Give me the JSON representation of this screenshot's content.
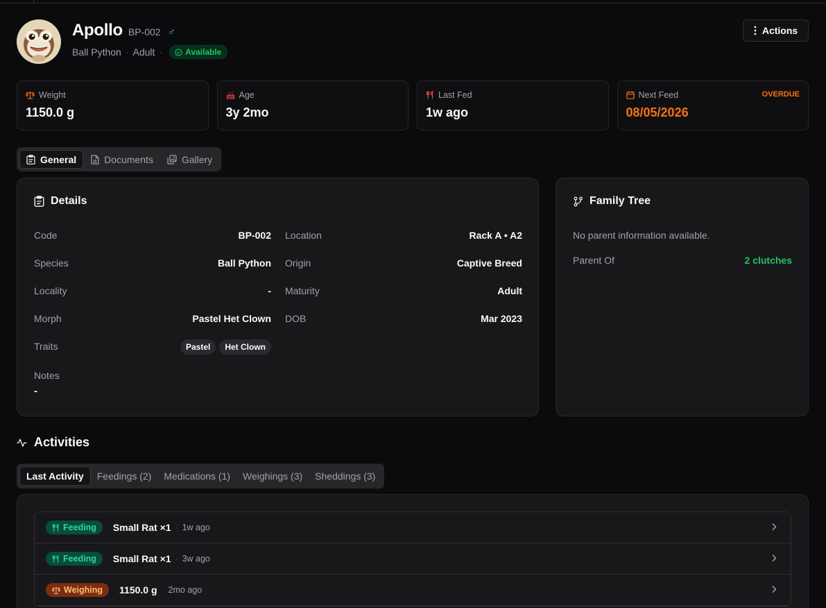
{
  "animal": {
    "name": "Apollo",
    "code": "BP-002",
    "sex_symbol": "♂",
    "species": "Ball Python",
    "maturity": "Adult",
    "status": "Available"
  },
  "header": {
    "actions_label": "Actions"
  },
  "stats": {
    "weight": {
      "label": "Weight",
      "value": "1150.0 g"
    },
    "age": {
      "label": "Age",
      "value": "3y 2mo"
    },
    "last_fed": {
      "label": "Last Fed",
      "value": "1w ago"
    },
    "next_feed": {
      "label": "Next Feed",
      "value": "08/05/2026",
      "flag": "OVERDUE"
    }
  },
  "tabs": [
    "General",
    "Documents",
    "Gallery"
  ],
  "details": {
    "title": "Details",
    "code": {
      "label": "Code",
      "value": "BP-002"
    },
    "species": {
      "label": "Species",
      "value": "Ball Python"
    },
    "locality": {
      "label": "Locality",
      "value": "-"
    },
    "morph": {
      "label": "Morph",
      "value": "Pastel Het Clown"
    },
    "traits": {
      "label": "Traits",
      "values": [
        "Pastel",
        "Het Clown"
      ]
    },
    "location": {
      "label": "Location",
      "value": "Rack A • A2"
    },
    "origin": {
      "label": "Origin",
      "value": "Captive Breed"
    },
    "maturity": {
      "label": "Maturity",
      "value": "Adult"
    },
    "dob": {
      "label": "DOB",
      "value": "Mar 2023"
    },
    "notes": {
      "label": "Notes",
      "value": "-"
    }
  },
  "family": {
    "title": "Family Tree",
    "empty_text": "No parent information available.",
    "parent_of_label": "Parent Of",
    "parent_of_value": "2 clutches"
  },
  "activities": {
    "title": "Activities",
    "tabs": [
      "Last Activity",
      "Feedings (2)",
      "Medications (1)",
      "Weighings (3)",
      "Sheddings (3)"
    ],
    "rows": [
      {
        "type": "Feeding",
        "detail": "Small Rat ×1",
        "time": "1w ago"
      },
      {
        "type": "Feeding",
        "detail": "Small Rat ×1",
        "time": "3w ago"
      },
      {
        "type": "Weighing",
        "detail": "1150.0 g",
        "time": "2mo ago"
      }
    ]
  },
  "colors": {
    "accent_green": "#22c55e",
    "overdue_orange": "#f97316",
    "sex_blue": "#60a5fa"
  },
  "icons": {
    "weight": "scale-icon",
    "age": "cake-icon",
    "last_fed": "utensils-icon",
    "next_feed": "calendar-icon"
  }
}
